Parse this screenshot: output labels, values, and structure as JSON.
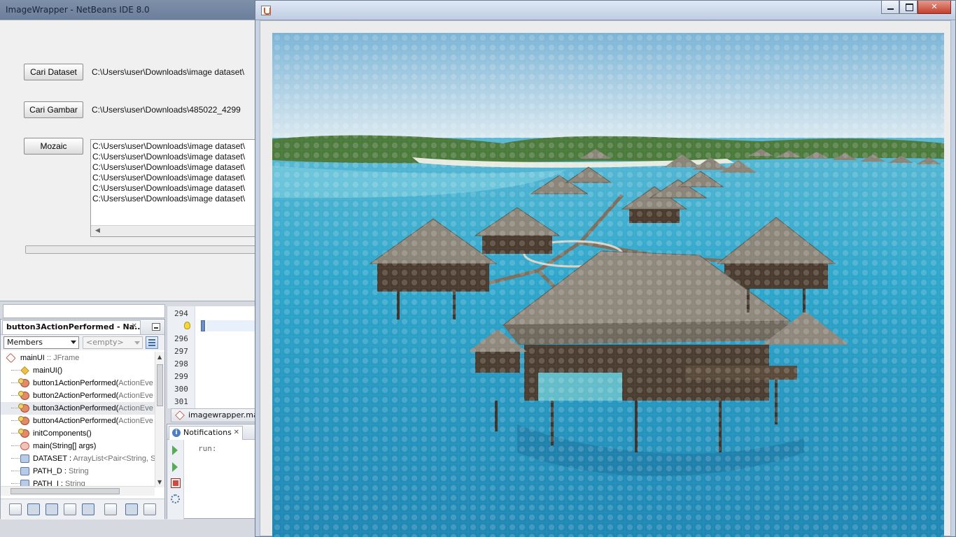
{
  "app_window": {
    "title": "ImageWrapper - NetBeans IDE 8.0",
    "buttons": {
      "search_dataset": "Cari Dataset",
      "search_image": "Cari Gambar",
      "mosaic": "Mozaic"
    },
    "dataset_path": "C:\\Users\\user\\Downloads\\image dataset\\",
    "image_path": "C:\\Users\\user\\Downloads\\485022_4299",
    "output_lines": [
      "C:\\Users\\user\\Downloads\\image dataset\\",
      "C:\\Users\\user\\Downloads\\image dataset\\",
      "C:\\Users\\user\\Downloads\\image dataset\\",
      "C:\\Users\\user\\Downloads\\image dataset\\",
      "C:\\Users\\user\\Downloads\\image dataset\\",
      "C:\\Users\\user\\Downloads\\image dataset\\"
    ],
    "progress": 0
  },
  "navigator": {
    "tab_title": "button3ActionPerformed - Na...",
    "members_filter": "Members",
    "empty_filter": "<empty>",
    "members": [
      {
        "name": "mainUI",
        "type": " :: JFrame",
        "icon": "class-icon"
      },
      {
        "name": "mainUI()",
        "type": "",
        "icon": "constructor-icon"
      },
      {
        "name": "button1ActionPerformed(",
        "type": "ActionEve",
        "icon": "method-icon"
      },
      {
        "name": "button2ActionPerformed(",
        "type": "ActionEve",
        "icon": "method-icon"
      },
      {
        "name": "button3ActionPerformed(",
        "type": "ActionEve",
        "icon": "method-icon"
      },
      {
        "name": "button4ActionPerformed(",
        "type": "ActionEve",
        "icon": "method-icon"
      },
      {
        "name": "initComponents()",
        "type": "",
        "icon": "method-icon"
      },
      {
        "name": "main(String[] args)",
        "type": "",
        "icon": "static-method-icon"
      },
      {
        "name": "DATASET : ",
        "type": "ArrayList<Pair<String, S",
        "icon": "field-icon"
      },
      {
        "name": "PATH_D : ",
        "type": "String",
        "icon": "field-icon"
      },
      {
        "name": "PATH_I : ",
        "type": "String",
        "icon": "field-icon"
      }
    ]
  },
  "editor": {
    "line_numbers": [
      "294",
      "",
      "296",
      "297",
      "298",
      "299",
      "300",
      "301"
    ],
    "file_tab": "imagewrapper.main"
  },
  "notifications": {
    "tab_title": "Notifications",
    "output_text": "run:"
  },
  "mosaic_window": {
    "title": ""
  },
  "colors": {
    "lagoon": "#2f9bc4",
    "sky": "#bcd9ec",
    "thatch": "#8a8478"
  }
}
